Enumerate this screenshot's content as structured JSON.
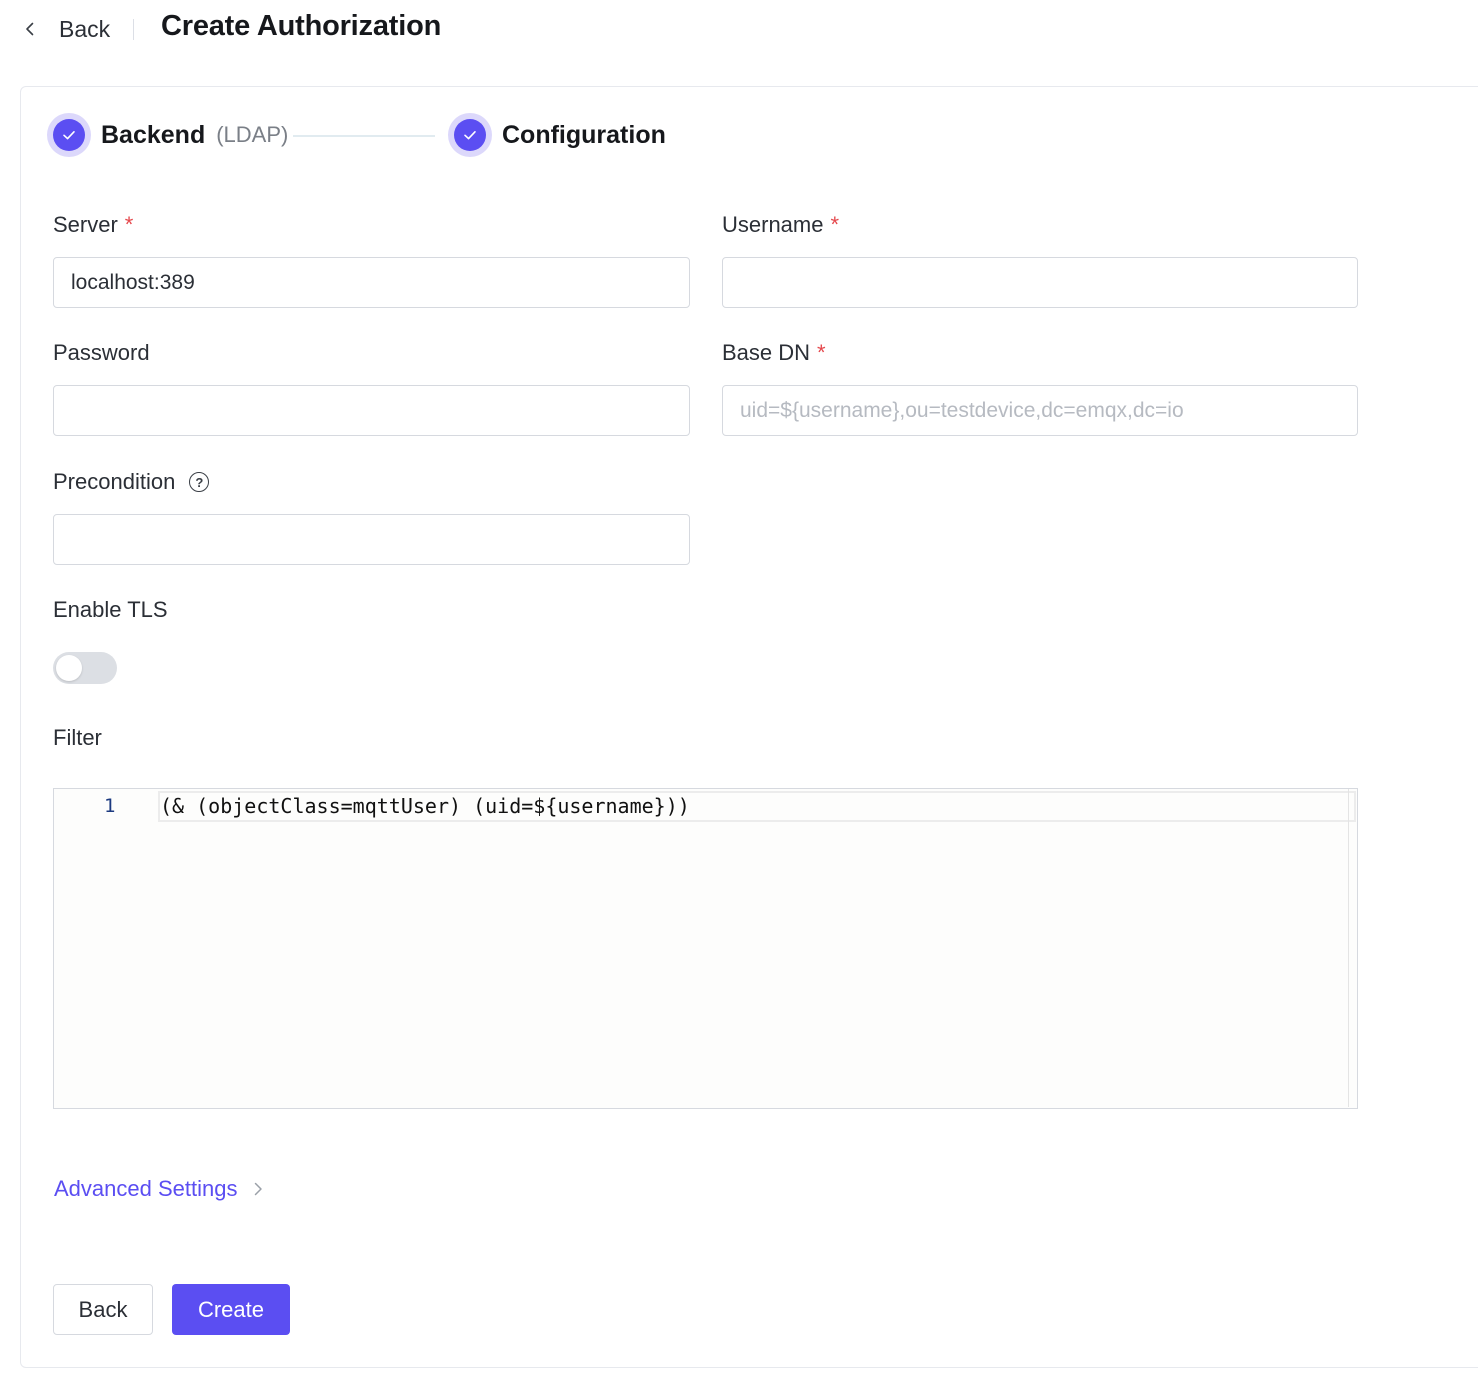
{
  "header": {
    "back_label": "Back",
    "title": "Create Authorization"
  },
  "steps": [
    {
      "title": "Backend",
      "subtitle": "(LDAP)",
      "status": "completed"
    },
    {
      "title": "Configuration",
      "subtitle": "",
      "status": "completed"
    }
  ],
  "form": {
    "server": {
      "label": "Server",
      "required_mark": "*",
      "value": "localhost:389",
      "placeholder": ""
    },
    "username": {
      "label": "Username",
      "required_mark": "*",
      "value": "",
      "placeholder": ""
    },
    "password": {
      "label": "Password",
      "value": "",
      "placeholder": ""
    },
    "base_dn": {
      "label": "Base DN",
      "required_mark": "*",
      "value": "",
      "placeholder": "uid=${username},ou=testdevice,dc=emqx,dc=io"
    },
    "precondition": {
      "label": "Precondition",
      "help_glyph": "?",
      "value": "",
      "placeholder": ""
    },
    "enable_tls": {
      "label": "Enable TLS",
      "enabled": false
    },
    "filter": {
      "label": "Filter",
      "line_number": "1",
      "code": "(& (objectClass=mqttUser) (uid=${username}))"
    }
  },
  "advanced_settings_label": "Advanced Settings",
  "footer": {
    "back_label": "Back",
    "create_label": "Create"
  },
  "colors": {
    "accent": "#5b4ef2",
    "required": "#e5484d"
  }
}
